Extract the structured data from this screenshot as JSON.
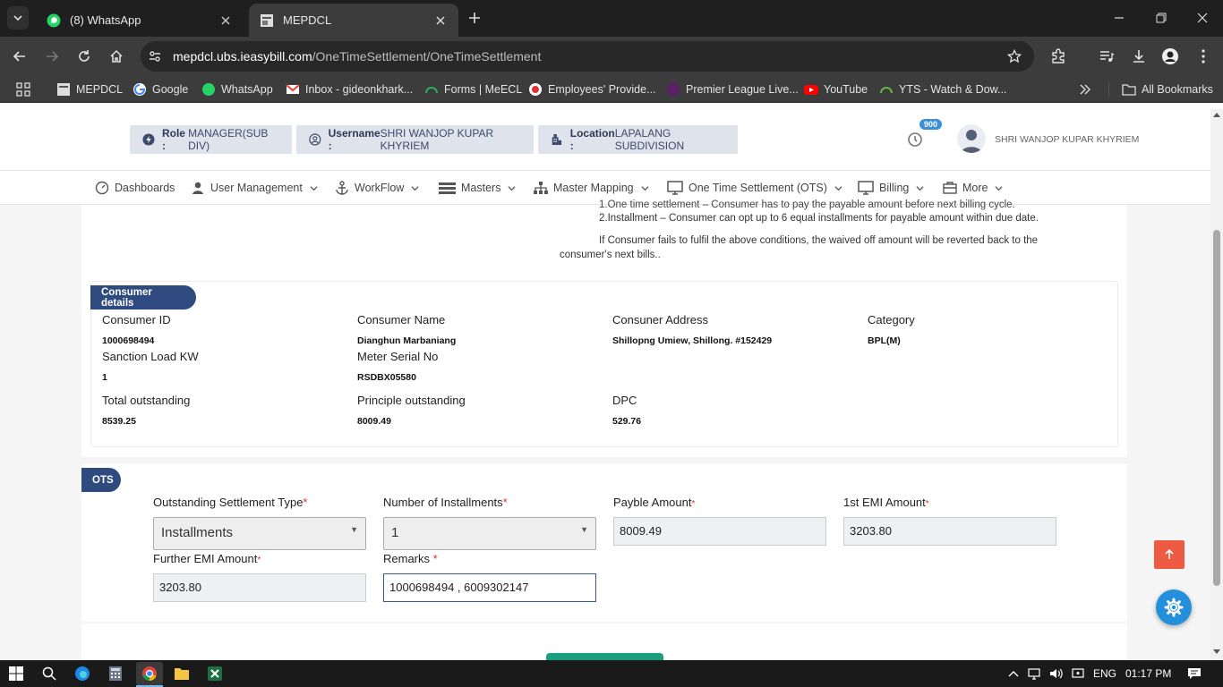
{
  "browser": {
    "tabs": [
      {
        "title": "(8) WhatsApp"
      },
      {
        "title": "MEPDCL"
      }
    ],
    "url_host": "mepdcl.ubs.ieasybill.com",
    "url_path": "/OneTimeSettlement/OneTimeSettlement",
    "bookmarks": [
      {
        "label": "MEPDCL",
        "icon": "mepdcl-favicon"
      },
      {
        "label": "Google",
        "icon": "google-icon"
      },
      {
        "label": "WhatsApp",
        "icon": "whatsapp-icon"
      },
      {
        "label": "Inbox - gideonkhark...",
        "icon": "gmail-icon"
      },
      {
        "label": "Forms | MeECL",
        "icon": "forms-icon"
      },
      {
        "label": "Employees' Provide...",
        "icon": "epf-icon"
      },
      {
        "label": "Premier League Live...",
        "icon": "premier-league-icon"
      },
      {
        "label": "YouTube",
        "icon": "youtube-icon"
      },
      {
        "label": "YTS - Watch & Dow...",
        "icon": "yts-icon"
      }
    ],
    "all_bookmarks": "All Bookmarks"
  },
  "header": {
    "role_label": "Role :",
    "role_value": "MANAGER(SUB DIV)",
    "username_label": "Username :",
    "username_value": "SHRI WANJOP KUPAR KHYRIEM",
    "location_label": "Location :",
    "location_value": "LAPALANG SUBDIVISION",
    "notification_count": "900",
    "user_display": "SHRI WANJOP KUPAR KHYRIEM"
  },
  "nav": [
    {
      "label": "Dashboards",
      "icon": "dashboard-icon"
    },
    {
      "label": "User Management",
      "icon": "user-icon"
    },
    {
      "label": "WorkFlow",
      "icon": "anchor-icon"
    },
    {
      "label": "Masters",
      "icon": "masters-icon"
    },
    {
      "label": "Master Mapping",
      "icon": "sitemap-icon"
    },
    {
      "label": "One Time Settlement (OTS)",
      "icon": "monitor-icon"
    },
    {
      "label": "Billing",
      "icon": "monitor-icon"
    },
    {
      "label": "More",
      "icon": "briefcase-icon"
    }
  ],
  "notes": {
    "line1": "1.One time settlement – Consumer has to pay the payable amount before next billing cycle.",
    "line2": "2.Installment – Consumer can opt up to 6 equal installments for payable amount within due date.",
    "line3": "If Consumer fails to fulfil the above conditions, the waived off amount will be reverted back to the",
    "line4": "consumer's next bills.."
  },
  "consumer_details": {
    "section_title": "Consumer details",
    "consumer_id_label": "Consumer ID",
    "consumer_id": "1000698494",
    "consumer_name_label": "Consumer Name",
    "consumer_name": "Dianghun Marbaniang",
    "address_label": "Consuner Address",
    "address": "Shillopng Umiew, Shillong. #152429",
    "category_label": "Category",
    "category": "BPL(M)",
    "sanction_load_label": "Sanction Load KW",
    "sanction_load": "1",
    "meter_serial_label": "Meter Serial No",
    "meter_serial": "RSDBX05580",
    "total_outstanding_label": "Total outstanding",
    "total_outstanding": "8539.25",
    "principle_outstanding_label": "Principle outstanding",
    "principle_outstanding": "8009.49",
    "dpc_label": "DPC",
    "dpc": "529.76"
  },
  "ots": {
    "section_title": "OTS",
    "settlement_type_label": "Outstanding Settlement Type",
    "settlement_type_value": "Installments",
    "installments_label": "Number of Installments",
    "installments_value": "1",
    "payable_label": "Payble Amount",
    "payable_value": "8009.49",
    "first_emi_label": "1st EMI Amount",
    "first_emi_value": "3203.80",
    "further_emi_label": "Further EMI Amount",
    "further_emi_value": "3203.80",
    "remarks_label": "Remarks",
    "remarks_value": "1000698494 , 6009302147",
    "required_mark": "*"
  },
  "taskbar": {
    "lang": "ENG",
    "time": "01:17 PM"
  },
  "colors": {
    "pill": "#2f4a7e",
    "accent_blue": "#2490dc",
    "to_top": "#ef5b42",
    "submit": "#199e7f"
  }
}
